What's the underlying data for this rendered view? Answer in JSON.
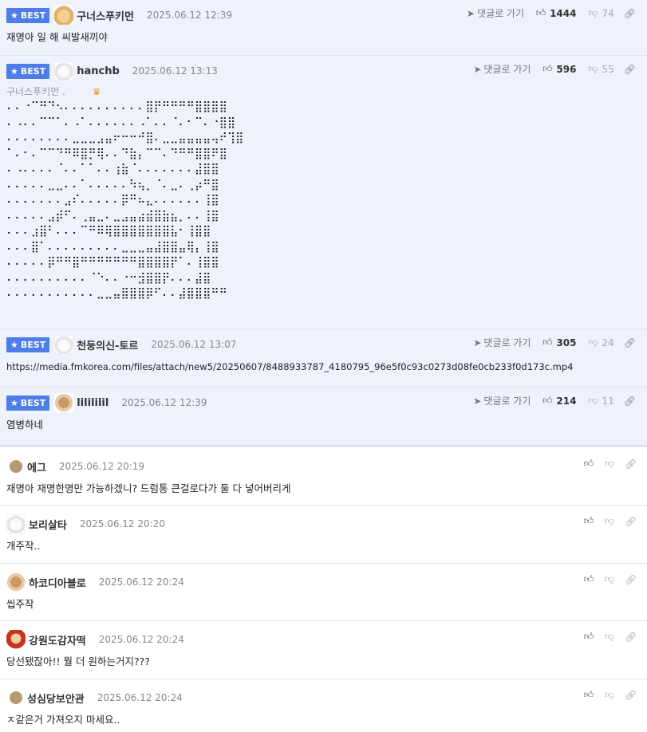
{
  "best_comments": [
    {
      "badge": "BEST",
      "nickname": "구너스푸키먼",
      "date": "2025.06.12 12:39",
      "goto_label": "댓글로 가기",
      "upvotes": "1444",
      "downvotes": "74",
      "text": "재명아 일 해 씨발새끼야",
      "avatar": "dog-yellow"
    },
    {
      "badge": "BEST",
      "nickname": "hanchb",
      "date": "2025.06.12 13:13",
      "goto_label": "댓글로 가기",
      "upvotes": "596",
      "downvotes": "55",
      "quote": "구너스푸키먼 .",
      "ascii": "⠄⠄⠐⠉⠛⠙⠢⠄⠄⠄⠄⠄⠄⠄⠄⠄⠄⣿⡟⠛⠛⠛⠛⣿⣿⣿⣿\n⠄⠠⠄⠄⠉⠉⠁⠄⠠⠁⠄⠄⠄⠄⠄⠄⠠⠁⠄⠄⠈⠄⠂⠉⠄⠐⣿⣿\n⠄⠄⠄⠄⠄⠄⠄⠄⣀⣀⣀⣠⣤⠖⠒⠒⠚⣿⠄⣀⣀⣤⣤⣤⣤⢤⠞⢹⣿\n⠁⠄⠂⠄⠉⠉⠙⠛⠿⣿⡛⢿⠄⠄⠙⣷⡄⠉⠉⠄⠙⠛⠛⣿⣿⠟⣿\n⠄⠠⠄⠄⠄⠄⠈⠄⠄⠁⠁⠄⠄⢰⣷⠈⠄⠄⠄⠄⠄⠄⠄⣼⣿⣿\n⠄⠄⠄⠄⠄⣀⣀⠄⠄⠁⠄⠄⠄⠄⠄⠳⢦⡀⠈⠄⣀⠄⢀⡴⠛⣿\n⠄⠄⠄⠄⠄⠄⠄⣠⠎⠄⠄⠄⠄⠄⡿⠛⠦⣄⠄⠄⠄⠄⠄⠄⢸⣿\n⠄⠄⠄⠄⠄⣠⡾⠋⠄⢀⣤⣀⠄⣀⣠⣤⣴⣾⣿⣷⣦⡀⠄⠄⢸⣿\n⠄⠄⠄⣰⣿⠃⠄⠄⠄⠉⠛⠿⢿⣿⣿⣿⣿⣿⣿⣿⣧⠂⢸⣿⣿\n⠄⠄⠄⣿⠁⠄⠄⠄⠄⠄⠄⠄⠄⠄⣀⣀⣀⣤⣼⣿⣿⣤⢿⡄⢸⣿\n⠄⠄⠄⠄⠄⡿⠛⠛⣿⠛⠛⠛⠛⠛⠛⠛⣿⣿⣿⣿⡟⠁⠄⢸⣿⣿\n⠄⠄⠄⠄⠄⠄⠄⠄⠄⠄⠈⠑⠄⠄⠐⠒⣺⣿⣿⡟⠄⠄⠄⣼⣿\n⠄⠄⠄⠄⠄⠄⠄⠄⠄⠄⠄⣀⣀⣤⣿⣿⣿⡿⠋⠄⠄⣼⣿⣿⣿⠛⠛",
      "avatar": "dog-white"
    },
    {
      "badge": "BEST",
      "nickname": "천둥의신-토르",
      "date": "2025.06.12 13:07",
      "goto_label": "댓글로 가기",
      "upvotes": "305",
      "downvotes": "24",
      "text": "https://media.fmkorea.com/files/attach/new5/20250607/8488933787_4180795_96e5f0c93c0273d08fe0cb233f0d173c.mp4",
      "avatar": "dog-white"
    },
    {
      "badge": "BEST",
      "nickname": "lilililil",
      "date": "2025.06.12 12:39",
      "goto_label": "댓글로 가기",
      "upvotes": "214",
      "downvotes": "11",
      "text": "염병하네",
      "avatar": "dog-brown"
    }
  ],
  "comments": [
    {
      "nickname": "에그",
      "date": "2025.06.12 20:19",
      "text": "재명아 재명한명만 가능하겠니? 드럼통 큰걸로다가 둘 다 넣어버리게",
      "avatar": "circle"
    },
    {
      "nickname": "보리살타",
      "date": "2025.06.12 20:20",
      "text": "개주작..",
      "avatar": "dog-white"
    },
    {
      "nickname": "하코디아블로",
      "date": "2025.06.12 20:24",
      "text": "씹주작",
      "avatar": "dog-brown"
    },
    {
      "nickname": "강원도감자떡",
      "date": "2025.06.12 20:24",
      "text": "당선됐잖아!! 뭘 더 원하는거지???",
      "avatar": "dog-red"
    },
    {
      "nickname": "성심당보안관",
      "date": "2025.06.12 20:24",
      "text": "ㅈ같은거 가져오지 마세요..",
      "avatar": "circle"
    }
  ],
  "icons": {
    "goto": "arrow-icon",
    "up": "thumbs-up-icon",
    "down": "thumbs-down-icon",
    "link": "link-icon"
  },
  "colors": {
    "best_badge": "#4d7de8",
    "best_bg": "#eef2fb"
  }
}
